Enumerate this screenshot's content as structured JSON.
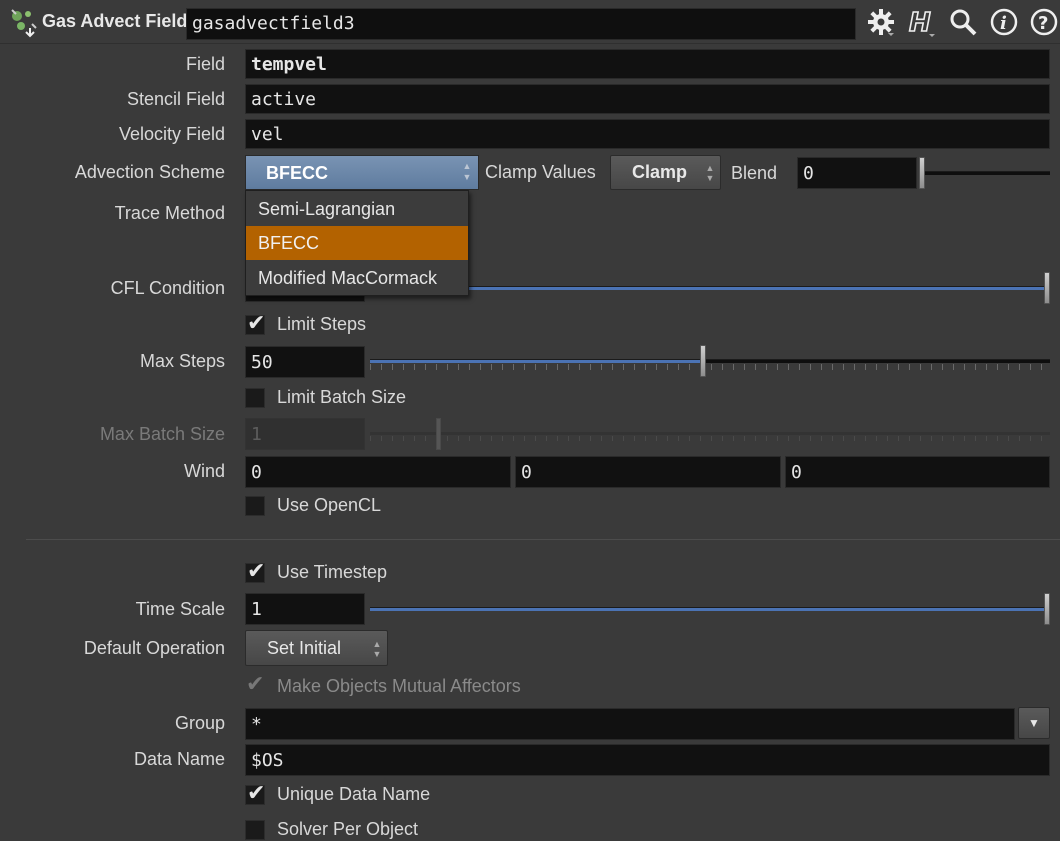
{
  "header": {
    "node_type": "Gas Advect Field",
    "node_name": "gasadvectfield3",
    "icons": [
      "gear-icon",
      "help-h-icon",
      "search-icon",
      "info-icon",
      "question-icon"
    ]
  },
  "params": {
    "field": {
      "label": "Field",
      "value": "tempvel"
    },
    "stencil_field": {
      "label": "Stencil Field",
      "value": "active"
    },
    "velocity_field": {
      "label": "Velocity Field",
      "value": "vel"
    },
    "advection_scheme": {
      "label": "Advection Scheme",
      "value": "BFECC"
    },
    "clamp_values": {
      "label": "Clamp Values",
      "value": "Clamp"
    },
    "blend": {
      "label": "Blend",
      "value": "0"
    },
    "trace_method": {
      "label": "Trace Method"
    },
    "cfl_condition": {
      "label": "CFL Condition"
    },
    "limit_steps": {
      "label": "Limit Steps",
      "checked": true
    },
    "max_steps": {
      "label": "Max Steps",
      "value": "50"
    },
    "limit_batch_size": {
      "label": "Limit Batch Size",
      "checked": false
    },
    "max_batch_size": {
      "label": "Max Batch Size",
      "value": "1"
    },
    "wind": {
      "label": "Wind",
      "x": "0",
      "y": "0",
      "z": "0"
    },
    "use_opencl": {
      "label": "Use OpenCL",
      "checked": false
    },
    "use_timestep": {
      "label": "Use Timestep",
      "checked": true
    },
    "time_scale": {
      "label": "Time Scale",
      "value": "1"
    },
    "default_operation": {
      "label": "Default Operation",
      "value": "Set Initial"
    },
    "mutual_affectors": {
      "label": "Make Objects Mutual Affectors",
      "checked": true
    },
    "group": {
      "label": "Group",
      "value": "*"
    },
    "data_name": {
      "label": "Data Name",
      "value": "$OS"
    },
    "unique_data_name": {
      "label": "Unique Data Name",
      "checked": true
    },
    "solver_per_object": {
      "label": "Solver Per Object",
      "checked": false
    }
  },
  "dropdown": {
    "options": [
      "Semi-Lagrangian",
      "BFECC",
      "Modified MacCormack"
    ],
    "selected": "BFECC"
  },
  "sliders": {
    "cfl_condition": 1.0,
    "max_steps": 0.49,
    "max_batch_size": 0.1,
    "time_scale": 1.0
  },
  "colors": {
    "accent_blue": "#4b73b4",
    "dropdown_selected": "#b36200",
    "background": "#3a3a3a"
  },
  "check_glyph": "✔",
  "updown_glyph_up": "▲",
  "updown_glyph_down": "▼",
  "menu_arrow": "▼"
}
